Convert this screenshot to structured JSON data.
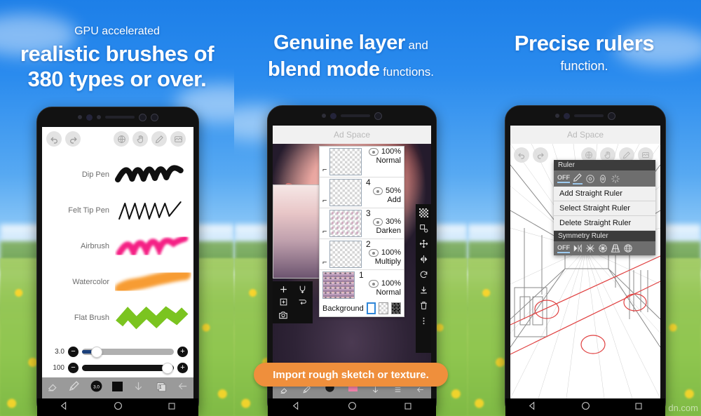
{
  "panels": [
    {
      "id": "panel-brushes",
      "heading_small": "GPU accelerated",
      "heading_line1": "realistic brushes of",
      "heading_line2": "380 types or over.",
      "toolbar_icons": [
        "undo-icon",
        "redo-icon",
        "globe-icon",
        "hand-icon",
        "pencil-icon",
        "layers-icon"
      ],
      "brushes": [
        {
          "name": "Dip Pen",
          "color": "#101010"
        },
        {
          "name": "Felt Tip Pen",
          "color": "#101010"
        },
        {
          "name": "Airbrush",
          "color": "#f4157f"
        },
        {
          "name": "Watercolor",
          "color": "#f79421"
        },
        {
          "name": "Flat Brush",
          "color": "#7bc420"
        }
      ],
      "sliders": [
        {
          "value": "3.0",
          "fill_percent": 9,
          "knob_percent": 13,
          "track": "light"
        },
        {
          "value": "100",
          "fill_percent": 0,
          "knob_percent": 94,
          "track": "dark"
        }
      ],
      "bottom_icons": [
        "eraser-icon",
        "brush-icon",
        "opacity-icon",
        "color-swatch-icon",
        "down-arrow-icon",
        "layer-count-icon",
        "back-arrow-icon"
      ],
      "layer_count": "1"
    },
    {
      "id": "panel-layers",
      "heading_big1": "Genuine layer",
      "heading_inline1": "and",
      "heading_big2": "blend mode",
      "heading_inline2": "functions.",
      "ad_label": "Ad Space",
      "layers": [
        {
          "number": "",
          "opacity": "100%",
          "mode": "Normal",
          "clipped": true,
          "has_art": false
        },
        {
          "number": "4",
          "opacity": "50%",
          "mode": "Add",
          "clipped": true,
          "has_art": false
        },
        {
          "number": "3",
          "opacity": "30%",
          "mode": "Darken",
          "clipped": true,
          "has_art": true
        },
        {
          "number": "2",
          "opacity": "100%",
          "mode": "Multiply",
          "clipped": true,
          "has_art": false
        },
        {
          "number": "1",
          "opacity": "100%",
          "mode": "Normal",
          "clipped": false,
          "has_art": true
        }
      ],
      "background_label": "Background",
      "background_swatches": [
        "white",
        "transparent",
        "dark-checker"
      ],
      "right_tool_icons": [
        "checker-icon",
        "transform-icon",
        "move-icon",
        "flip-icon",
        "rotate-icon",
        "download-icon",
        "trash-icon",
        "more-icon"
      ],
      "left_tool_icons": [
        "add-layer-icon",
        "merge-icon",
        "duplicate-icon",
        "flip-layer-icon",
        "camera-icon"
      ],
      "mode_value": "Normal",
      "mode_bar_icons": [
        "clip-icon",
        "lock-icon",
        "up-arrow-icon"
      ],
      "banner_text": "Import rough sketch or texture."
    },
    {
      "id": "panel-rulers",
      "heading_big": "Precise rulers",
      "heading_small": "function.",
      "ad_label": "Ad Space",
      "toolbar_icons": [
        "undo-icon",
        "redo-icon",
        "globe-icon",
        "hand-icon",
        "pencil-icon",
        "layers-icon"
      ],
      "ruler_menu": {
        "title": "Ruler",
        "off_label": "OFF",
        "mode_icons": [
          "straight-ruler-icon",
          "circle-ruler-icon",
          "ellipse-ruler-icon",
          "radial-ruler-icon"
        ],
        "items": [
          "Add Straight Ruler",
          "Select Straight Ruler",
          "Delete Straight Ruler"
        ],
        "symmetry_title": "Symmetry Ruler",
        "symmetry_off_label": "OFF",
        "symmetry_icons": [
          "mirror-icon",
          "kaleido-icon",
          "radial-symmetry-icon",
          "perspective-icon",
          "globe-symmetry-icon"
        ]
      }
    }
  ],
  "nav_icons": [
    "back-triangle-icon",
    "home-circle-icon",
    "recents-square-icon"
  ],
  "watermark": "dn.com",
  "colors": {
    "sky_top": "#1d7fe8",
    "banner": "#ef8f3c",
    "accent_blue": "#2f86d8"
  }
}
